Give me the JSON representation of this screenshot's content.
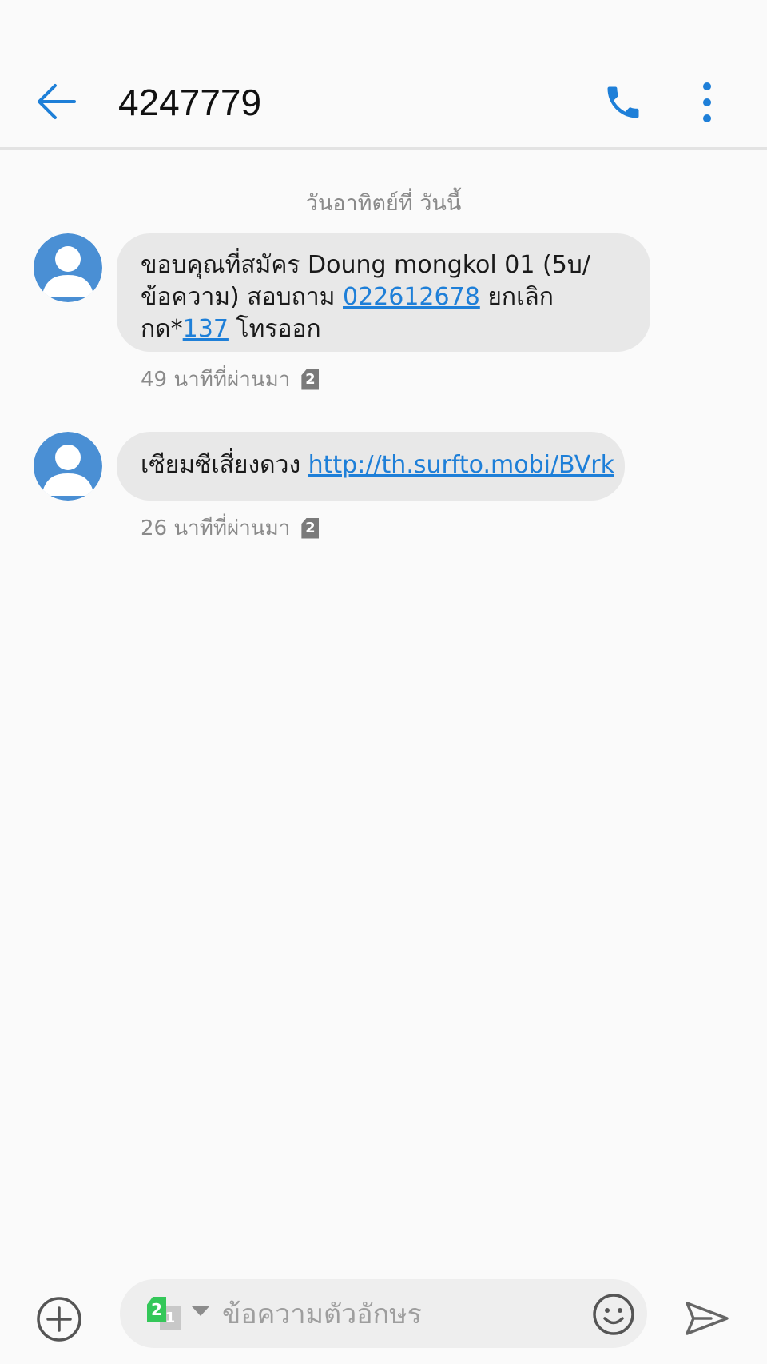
{
  "header": {
    "title": "4247779",
    "back_icon": "arrow-left-icon",
    "call_icon": "phone-icon",
    "more_icon": "more-vertical-icon",
    "accent_color": "#1e7fd8"
  },
  "conversation": {
    "day_label": "วันอาทิตย์ที่ วันนี้",
    "messages": [
      {
        "text_1": "ขอบคุณที่สมัคร Doung mongkol 01 (5บ/ข้อความ) สอบถาม ",
        "link_1": "022612678",
        "text_2": " ยกเลิกกด*",
        "link_2": "137",
        "text_3": " โทรออก",
        "time": "49 นาทีที่ผ่านมา",
        "sim": "2"
      },
      {
        "text_1": "เซียมซีเสี่ยงดวง ",
        "link_1": "http://th.surfto.mobi/BVrk",
        "time": "26 นาทีที่ผ่านมา",
        "sim": "2"
      }
    ]
  },
  "composer": {
    "placeholder": "ข้อความตัวอักษร",
    "sim_active": "2",
    "sim_inactive": "1",
    "add_icon": "plus-circle-icon",
    "emoji_icon": "emoji-icon",
    "send_icon": "send-icon"
  }
}
